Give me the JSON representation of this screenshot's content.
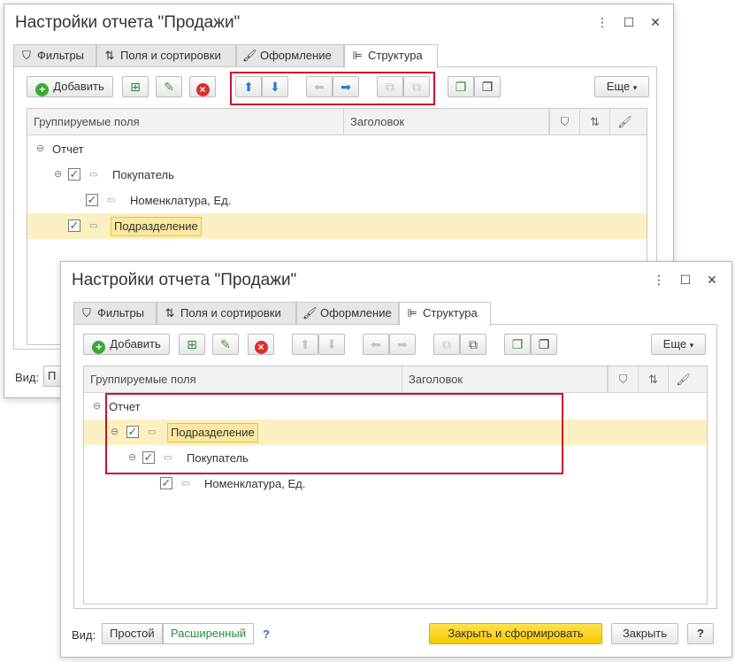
{
  "title": "Настройки отчета \"Продажи\"",
  "window_controls": {
    "more": "⋮",
    "maximize": "☐",
    "close": "✕"
  },
  "tabs": [
    {
      "label": "Фильтры",
      "icon": "filter-icon"
    },
    {
      "label": "Поля и сортировки",
      "icon": "fields-sort-icon"
    },
    {
      "label": "Оформление",
      "icon": "brush-icon"
    },
    {
      "label": "Структура",
      "icon": "structure-icon"
    }
  ],
  "toolbar": {
    "add_label": "Добавить",
    "more_label": "Еще"
  },
  "columns": {
    "fields": "Группируемые поля",
    "header": "Заголовок"
  },
  "tree_before": {
    "root": "Отчет",
    "rows": [
      "Покупатель",
      "Номенклатура, Ед.",
      "Подразделение"
    ]
  },
  "tree_after": {
    "root": "Отчет",
    "rows": [
      "Подразделение",
      "Покупатель",
      "Номенклатура, Ед."
    ]
  },
  "view": {
    "label": "Вид:",
    "cut_label": "П",
    "options": [
      "Простой",
      "Расширенный"
    ],
    "selected": "Расширенный",
    "help": "?"
  },
  "footer": {
    "primary_label": "Закрыть и сформировать",
    "close_label": "Закрыть",
    "help_label": "?"
  },
  "colors": {
    "highlight_border": "#c8102e",
    "selected_row": "#fbf0c2",
    "primary_button": "#f5c800",
    "check": "#1b8a22"
  }
}
